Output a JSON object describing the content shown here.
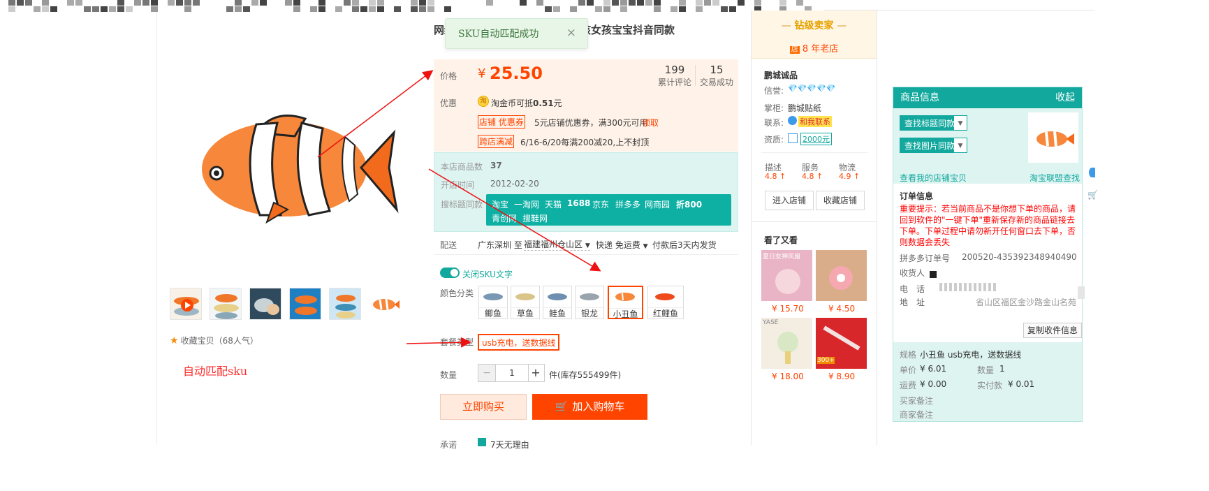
{
  "toast": {
    "message": "SKU自动匹配成功",
    "close": "×"
  },
  "product": {
    "title": "网红电动鱼会动玩具儿童游泳男孩女孩宝宝抖音同款",
    "price_label": "价格",
    "currency": "¥",
    "price": "25.50",
    "stats": [
      {
        "value": "199",
        "label": "累计评论"
      },
      {
        "value": "15",
        "label": "交易成功"
      }
    ],
    "promo_label": "优惠",
    "coin_text_prefix": "淘金币可抵",
    "coin_amount": "0.51",
    "coin_unit": "元",
    "coupon_tag": "店铺 优惠券",
    "coupon_text_a": "5元店铺优惠券，满",
    "coupon_text_b": "300",
    "coupon_text_c": "元可用",
    "coupon_link": "领取",
    "cross_tag": "跨店满减",
    "cross_text": "6/16-6/20每满200减20,上不封顶",
    "shop_count_label": "本店商品数",
    "shop_count": "37",
    "open_date_label": "开店时间",
    "open_date": "2012-02-20",
    "search_label": "搜标题同款",
    "search_sites": [
      "淘宝",
      "一淘网",
      "天猫",
      "1688",
      "京东",
      "拼多多",
      "网商园",
      "折800",
      "青创网",
      "搜鞋网"
    ],
    "ship_label": "配送",
    "ship_from": "广东深圳 至",
    "ship_to": "福建福州仓山区",
    "ship_method": "快递 免运费",
    "ship_time": "付款后3天内发货",
    "sku_toggle": "关闭SKU文字",
    "color_label": "颜色分类",
    "colors": [
      "鲫鱼",
      "草鱼",
      "鲑鱼",
      "银龙",
      "小丑鱼",
      "红鲤鱼"
    ],
    "package_label": "套餐类型",
    "package_value": "usb充电，送数据线",
    "qty_label": "数量",
    "qty": "1",
    "qty_minus": "−",
    "qty_plus": "+",
    "stock": "件(库存555499件)",
    "buy_now": "立即购买",
    "add_cart": "加入购物车",
    "promise_label": "承诺",
    "promise_text": "7天无理由"
  },
  "gallery": {
    "favorite": "收藏宝贝（68人气）",
    "annotation": "自动匹配sku"
  },
  "seller": {
    "level": "钻级卖家",
    "years": "8 年老店",
    "shop_icon": "店",
    "shop_name": "鹏城诚品",
    "credit_label": "信誉:",
    "credit_diamonds": "💎💎💎💎💎",
    "keeper_label": "掌柜:",
    "keeper": "鹏城贴纸",
    "contact_label": "联系:",
    "contact": "和我联系",
    "qual_label": "资质:",
    "deposit": "2000元",
    "scores": [
      {
        "label": "描述",
        "value": "4.8"
      },
      {
        "label": "服务",
        "value": "4.8"
      },
      {
        "label": "物流",
        "value": "4.9"
      }
    ],
    "enter_shop": "进入店铺",
    "fav_shop": "收藏店铺",
    "seen_title": "看了又看",
    "recs": [
      {
        "price": "¥ 15.70",
        "banner": "夏日女神风扇"
      },
      {
        "price": "¥ 4.50",
        "banner": ""
      },
      {
        "price": "¥ 18.00",
        "banner": "YASE"
      },
      {
        "price": "¥ 8.90",
        "banner": "300+"
      }
    ]
  },
  "panel": {
    "title": "商品信息",
    "collapse": "收起",
    "find_title": "查找标题同款",
    "find_image": "查找图片同款",
    "my_coupon": "查看我的店铺宝贝",
    "alliance": "淘宝联盟查找",
    "order_title": "订单信息",
    "warning": "重要提示：若当前商品不是你想下单的商品，请回到软件的\"一键下单\"重新保存新的商品链接去下单。下单过程中请勿新开任何窗口去下单，否则数据会丢失",
    "pdd_label": "拼多多订单号",
    "pdd_value": "200520-435392348940490",
    "receiver_label": "收货人",
    "phone_label": "电　话",
    "addr_label": "地　址",
    "addr_value": "省山区福区金沙路金山名苑",
    "copy_btn": "复制收件信息",
    "spec_label": "规格",
    "spec_value": "小丑鱼  usb充电，送数据线",
    "unit_label": "单价",
    "unit_value": "¥ 6.01",
    "count_label": "数量",
    "count_value": "1",
    "ship_label": "运费",
    "ship_value": "¥ 0.00",
    "paid_label": "实付款",
    "paid_value": "¥ 0.01",
    "buyer_note": "买家备注",
    "seller_note": "商家备注"
  },
  "colors": {
    "accent": "#ff4400",
    "teal": "#13a89e",
    "arrow": "#ee1111"
  }
}
